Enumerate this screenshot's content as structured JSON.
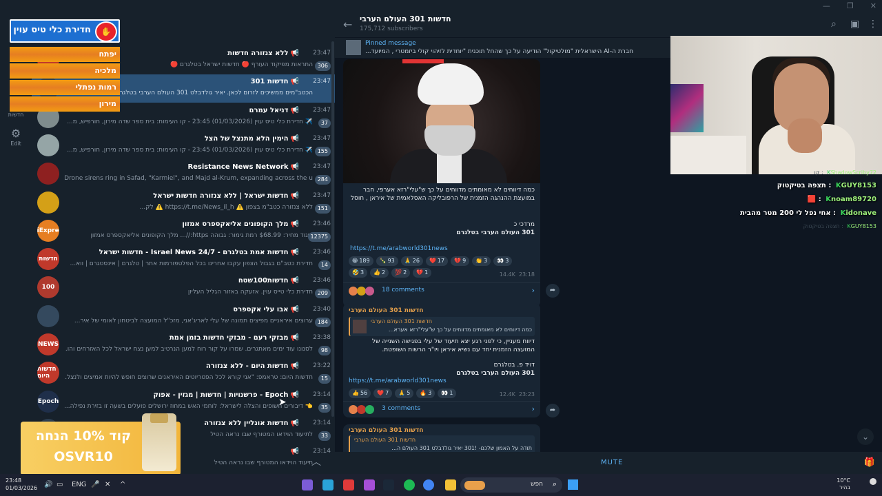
{
  "window": {
    "controls": [
      "—",
      "❐",
      "✕"
    ]
  },
  "rail": {
    "items": [
      {
        "label": "חדשות",
        "icon": "folder-icon"
      },
      {
        "label": "Edit",
        "icon": "sliders-icon"
      }
    ]
  },
  "overlay": {
    "brand_title": "חדירת כלי טיס עוין",
    "alerts": [
      "יפתח",
      "מלכיה",
      "רמות נפתלי",
      "מירון"
    ],
    "promo": "קוד 10% הנחה OSVR10"
  },
  "chats": [
    {
      "title": "ללא צנזורה חדשות",
      "time": "23:47",
      "preview": "התראות מפיקוד העורף 🔴 חדשות ישראל בטלגרם 🔴",
      "badge": "306",
      "avatar": "#c0392b",
      "avtext": ""
    },
    {
      "title": "חדשות 301",
      "time": "23:47",
      "preview": "הכטב\"מים ממשיכים לזרום לכאן. יאיר גולדבלט 301 העולם הערבי בטלגרם",
      "badge": "",
      "avatar": "#2c3e50",
      "avtext": ""
    },
    {
      "title": "דניאל עמרם",
      "time": "23:47",
      "preview": "✈️ חדירת כלי טיס עוין (01/03/2026) 23:45 - קו העימות: בית ספר שדה מירון, חורפיש, מ...",
      "badge": "37",
      "avatar": "#7f8c8d",
      "avtext": ""
    },
    {
      "title": "הימין הלא מתנצל של הצל",
      "time": "23:47",
      "preview": "✈️ חדירת כלי טיס עוין (01/03/2026) 23:45 - קו העימות: בית ספר שדה מירון, חורפיש, מ...",
      "badge": "155",
      "avatar": "#95a5a6",
      "avtext": ""
    },
    {
      "title": "Resistance News Network",
      "time": "23:47",
      "preview": "Drone sirens ring in Safad, \"Karmiel\", and Majd al-Krum, expanding across the u...",
      "badge": "284",
      "avatar": "#8e2020",
      "avtext": ""
    },
    {
      "title": "חדשות ישראל | ללא צנזורה חדשות ישראל",
      "time": "23:47",
      "preview": "ללא צנזורה כטב\"מ בצפון ⚠️ https://t.me/News_il_h ⚠️ לק...",
      "badge": "151",
      "avatar": "#d4a017",
      "avtext": ""
    },
    {
      "title": "מלך הקופונים אליאקספרס אמזון",
      "time": "23:46",
      "preview": "ביגוד מחיר: $68.99 רמת גימור: גבוהה https://... מלך הקופונים אליאקספרס אמזון",
      "badge": "12375",
      "avatar": "#e67e22",
      "avtext": "AliExpress"
    },
    {
      "title": "חדשות אמת בטלגרם - Israel News 24/7 - חדשות ישראל",
      "time": "23:46",
      "preview": "חדירת כטב\"ם בגבול הצפון עקבו אחרינו בכל הפלטפורמות אתר | טלגרם | אינסטגרם | ווא...",
      "badge": "14",
      "avatar": "#c0392b",
      "avtext": "חדשות"
    },
    {
      "title": "חדשות100שטח",
      "time": "23:46",
      "preview": "חדירת כלי טייס עוין. אזעקה באזור הגליל העליון",
      "badge": "209",
      "avatar": "#b03a2e",
      "avtext": "100"
    },
    {
      "title": "אבו עלי אקספרס",
      "time": "23:40",
      "preview": "ערוצים איראניים מפיצים תמונה של עלי לאריג'אני, מזכ\"ל המועצה לביטחון לאומי של איר...",
      "badge": "184",
      "avatar": "#34495e",
      "avtext": ""
    },
    {
      "title": "מבזקי רעם - מבזקי חדשות בזמן אמת",
      "time": "23:38",
      "preview": "לסנונו עוד ימים מאתגרים. שמרו על קור רוח למען הנרטיב למען נצח ישראל לכל האזרחים והו...",
      "badge": "98",
      "avatar": "#c0392b",
      "avtext": "NEWS"
    },
    {
      "title": "חדשות היום - ללא צנזורה",
      "time": "23:22",
      "preview": "חדשות היום: טראמפ: \"אני קורא לכל הפטריוטים האיראנים שרוצים חופש להיות אמיצים ולנצל...",
      "badge": "15",
      "avatar": "#c0392b",
      "avtext": "חדשות היום"
    },
    {
      "title": "Epoch - פרשנויות | חדשות | מגזין - אפוק",
      "time": "23:14",
      "preview": "👈 דיבורים חשופים והצלה לישראל: לוחמי האש במחוז ירושלים פועלים בשעה זו בזירת נפילה...",
      "badge": "35",
      "avatar": "#1f2f4a",
      "avtext": "Epoch"
    },
    {
      "title": "חדשות אונליין ללא צנזורה",
      "time": "23:14",
      "preview": "לתיעוד הוידאו המטורף שבו נראה הטיל",
      "badge": "33",
      "avatar": "#2c3e50",
      "avtext": ""
    },
    {
      "title": "",
      "time": "23:14",
      "preview": "תיעוד הוידאו המטורף שבו נראה הטיל",
      "badge": "",
      "avatar": "#2c3e50",
      "avtext": ""
    }
  ],
  "main": {
    "title": "חדשות 301 העולם הערבי",
    "subscribers": "175,712 subscribers",
    "pinned_label": "Pinned message",
    "pinned_text": "חברת ה-AI הישראלית \"מולטיקול\" הודיעה על כך שהחל תוכנית \"יוחדית לזיהוי קולי ביזמטרי , המיועד...",
    "post1": {
      "text": "כמה דיווחים לא מאומתים מדווחים על כך ש\"עלי\"רזא אערפי, חבר במועצת ההנהגה הזמנית של הרפובליקה האסלאמית של איראן , חוסל",
      "signature": "מרדכי כ",
      "channel": "301 העולם הערבי בטלגרם",
      "link": "https://t.me/arabworld301news",
      "reactions": [
        [
          "😁",
          "189"
        ],
        [
          "🍾",
          "93"
        ],
        [
          "🙏",
          "26"
        ],
        [
          "❤️",
          "17"
        ],
        [
          "💔",
          "9"
        ],
        [
          "👏",
          "3"
        ],
        [
          "👀",
          "3"
        ],
        [
          "🤣",
          "3"
        ],
        [
          "👍",
          "2"
        ],
        [
          "💯",
          "2"
        ],
        [
          "💔",
          "1"
        ]
      ],
      "views": "14.4K",
      "time": "23:18",
      "comments": "18 comments"
    },
    "post2": {
      "sender": "חדשות 301 העולם הערבי",
      "reply_name": "חדשות 301 העולם הערבי",
      "reply_text": "כמה דיווחים לא מאומתים מדווחים על כך ש\"עלי\"רזא אערא...",
      "text": "דיווח מעניין, כי לפני רגע יצא תיעוד של עלי בפגישה השנייה של המועצה הזמנית יחד עם נשיא איראן ויו\"ר הרשות השופטת.",
      "signature": "דויד פ. בטלגרם",
      "channel": "301 העולם הערבי בטלגרם",
      "link": "https://t.me/arabworld301news",
      "reactions": [
        [
          "👍",
          "56"
        ],
        [
          "❤️",
          "7"
        ],
        [
          "🙏",
          "5"
        ],
        [
          "🔥",
          "3"
        ],
        [
          "👀",
          "1"
        ]
      ],
      "views": "12.4K",
      "time": "23:23",
      "comments": "3 comments"
    },
    "post3": {
      "sender": "חדשות 301 העולם הערבי",
      "reply_name": "חדשות 301 העולם הערבי",
      "reply_text": "תודה על האמון שלכם- !301 יאיר גולדבלט 301 העולם ה..."
    },
    "mute": "MUTE"
  },
  "livechat": [
    {
      "user": "ShadowScriby72",
      "msg": "קו",
      "faded": true
    },
    {
      "user": "GUY8153",
      "msg": "תצפה בטיקטוק"
    },
    {
      "user": "noam89720",
      "msg": "🟥"
    },
    {
      "user": "idonave",
      "msg": "אחי נפל לי 200 מטר מהבית"
    },
    {
      "user": "GUY8153",
      "msg": "תצפה בטיקטוק",
      "faded": true
    }
  ],
  "taskbar": {
    "time": "23:48",
    "date": "01/03/2026",
    "lang": "ENG",
    "search": "חפש",
    "temp": "10°C",
    "weather": "בהיר"
  }
}
